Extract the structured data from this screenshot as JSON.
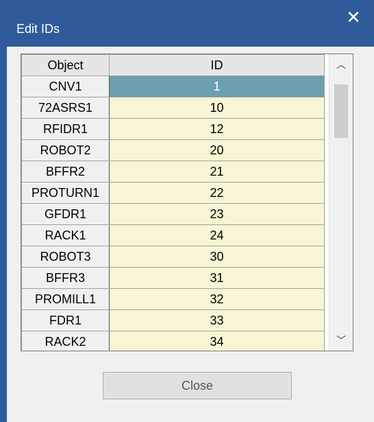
{
  "window": {
    "title": "Edit IDs",
    "close_glyph": "✕"
  },
  "grid": {
    "columns": [
      "Object",
      "ID"
    ],
    "rows": [
      {
        "object": "CNV1",
        "id": "1",
        "selected": true
      },
      {
        "object": "72ASRS1",
        "id": "10"
      },
      {
        "object": "RFIDR1",
        "id": "12"
      },
      {
        "object": "ROBOT2",
        "id": "20"
      },
      {
        "object": "BFFR2",
        "id": "21"
      },
      {
        "object": "PROTURN1",
        "id": "22"
      },
      {
        "object": "GFDR1",
        "id": "23"
      },
      {
        "object": "RACK1",
        "id": "24"
      },
      {
        "object": "ROBOT3",
        "id": "30"
      },
      {
        "object": "BFFR3",
        "id": "31"
      },
      {
        "object": "PROMILL1",
        "id": "32"
      },
      {
        "object": "FDR1",
        "id": "33"
      },
      {
        "object": "RACK2",
        "id": "34"
      }
    ],
    "scroll_up_glyph": "︿",
    "scroll_down_glyph": "﹀"
  },
  "buttons": {
    "close_label": "Close"
  },
  "colors": {
    "titlebar": "#2f5b9a",
    "id_cell_bg": "#f7f5d3",
    "selected_bg": "#6b9fb0"
  }
}
